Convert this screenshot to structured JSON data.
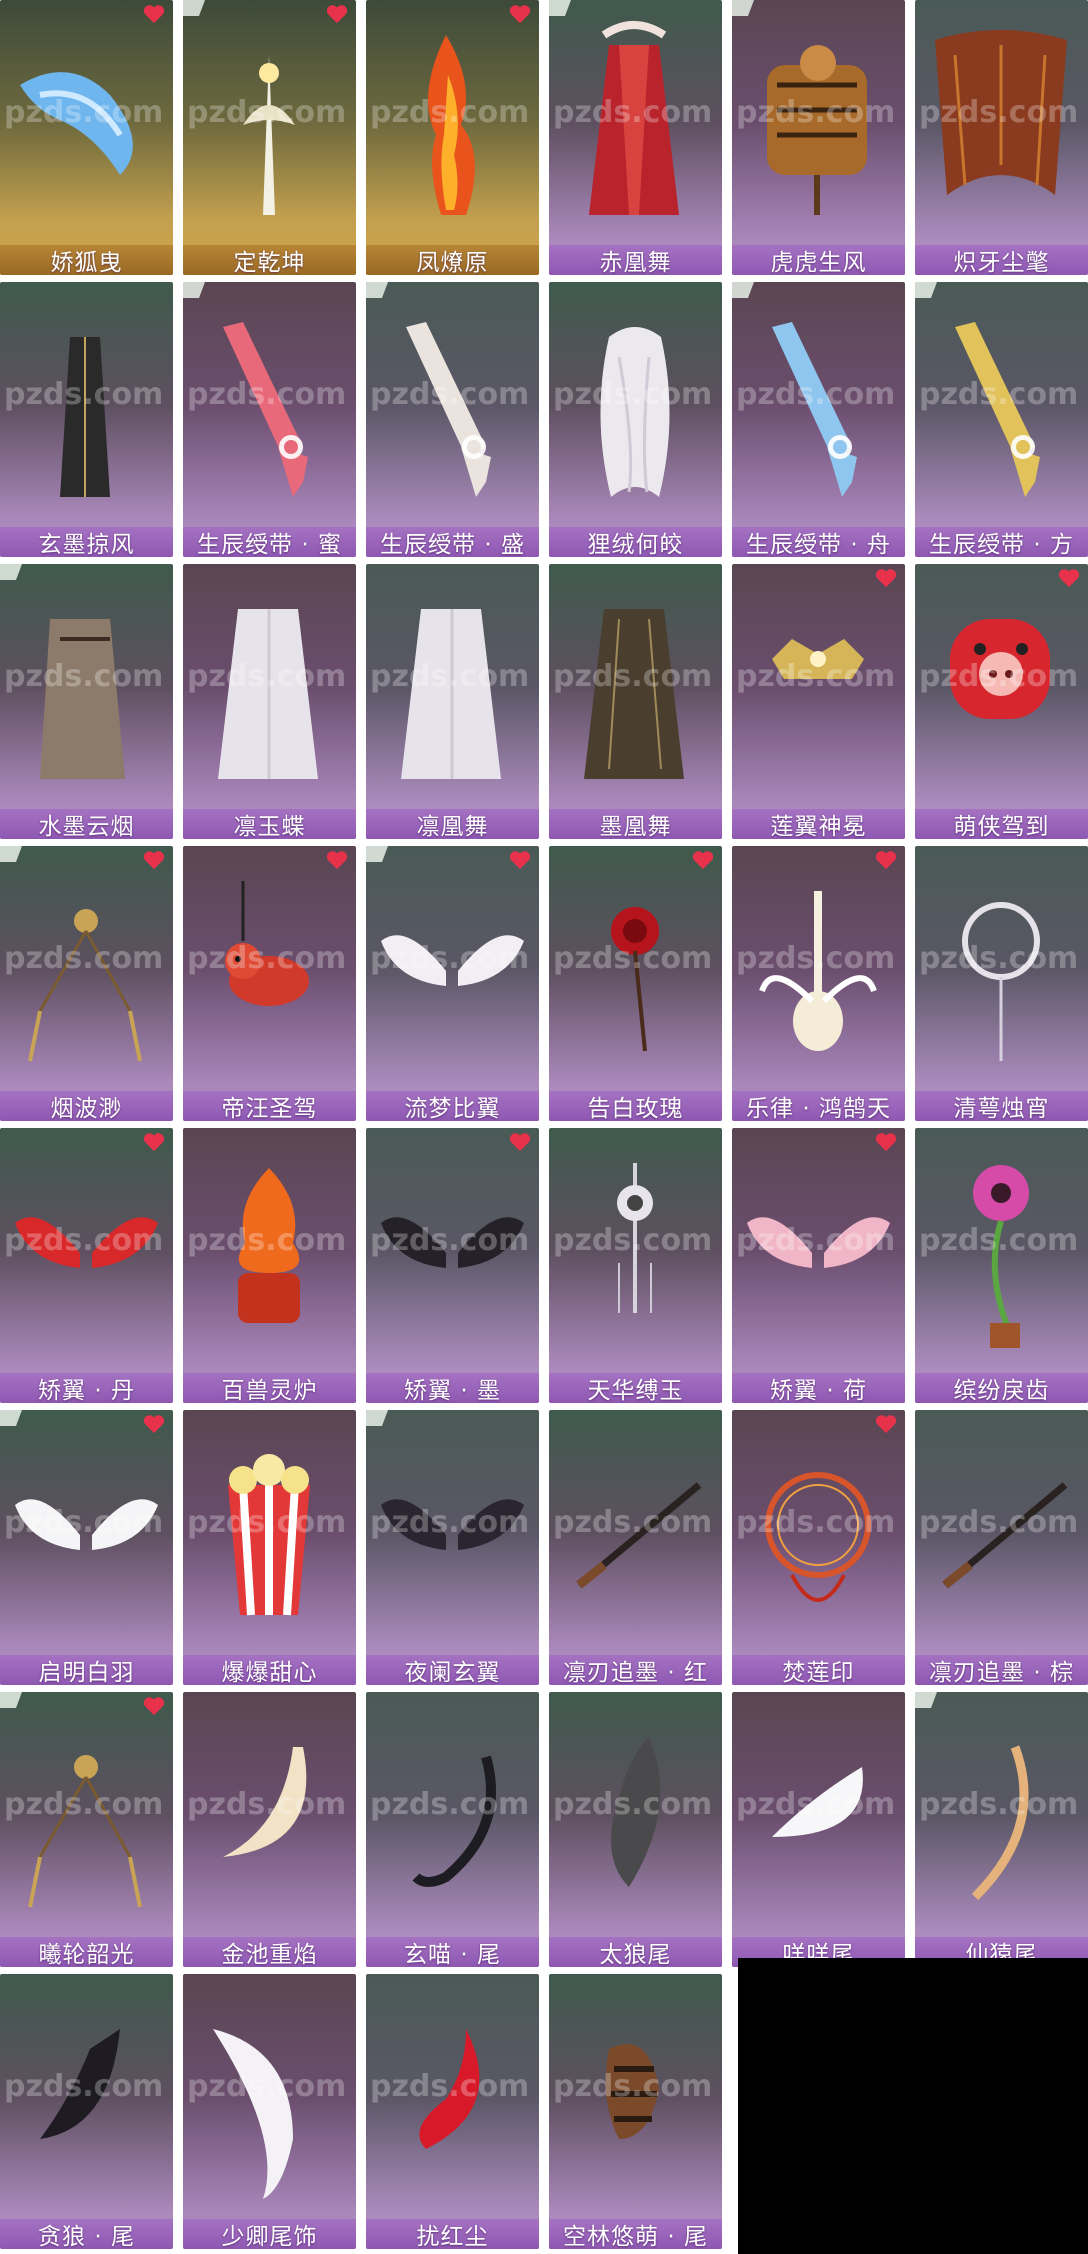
{
  "watermark": "pzds.com",
  "items": [
    {
      "name": "娇狐曳",
      "heart": true,
      "tag": false,
      "theme": "gold",
      "art": "tail-blue"
    },
    {
      "name": "定乾坤",
      "heart": true,
      "tag": true,
      "theme": "gold",
      "art": "sword-white"
    },
    {
      "name": "凤燎原",
      "heart": true,
      "tag": false,
      "theme": "gold",
      "art": "flame"
    },
    {
      "name": "赤凰舞",
      "heart": false,
      "tag": true,
      "theme": "purple",
      "art": "robe-red"
    },
    {
      "name": "虎虎生风",
      "heart": false,
      "tag": true,
      "theme": "purple",
      "art": "tiger"
    },
    {
      "name": "炽牙尘氅",
      "heart": false,
      "tag": false,
      "theme": "purple",
      "art": "cape-brown"
    },
    {
      "name": "玄墨掠风",
      "heart": false,
      "tag": false,
      "theme": "purple",
      "art": "cape-black"
    },
    {
      "name": "生辰绶带 · 蜜",
      "heart": false,
      "tag": true,
      "theme": "purple",
      "art": "sash-pink"
    },
    {
      "name": "生辰绶带 · 盛",
      "heart": false,
      "tag": true,
      "theme": "purple",
      "art": "sash-white"
    },
    {
      "name": "狸绒何皎",
      "heart": false,
      "tag": false,
      "theme": "purple",
      "art": "fur-white"
    },
    {
      "name": "生辰绶带 · 舟",
      "heart": false,
      "tag": true,
      "theme": "purple",
      "art": "sash-blue"
    },
    {
      "name": "生辰绶带 · 方",
      "heart": false,
      "tag": true,
      "theme": "purple",
      "art": "sash-gold"
    },
    {
      "name": "水墨云烟",
      "heart": false,
      "tag": true,
      "theme": "purple",
      "art": "robe-ink"
    },
    {
      "name": "凛玉蝶",
      "heart": false,
      "tag": false,
      "theme": "purple",
      "art": "robe-white"
    },
    {
      "name": "凛凰舞",
      "heart": false,
      "tag": false,
      "theme": "purple",
      "art": "robe-white2"
    },
    {
      "name": "墨凰舞",
      "heart": false,
      "tag": false,
      "theme": "purple",
      "art": "robe-dark"
    },
    {
      "name": "莲翼神冕",
      "heart": true,
      "tag": false,
      "theme": "purple",
      "art": "crown"
    },
    {
      "name": "萌侠驾到",
      "heart": true,
      "tag": false,
      "theme": "purple",
      "art": "pig"
    },
    {
      "name": "烟波渺",
      "heart": true,
      "tag": true,
      "theme": "purple",
      "art": "tassel"
    },
    {
      "name": "帝汪圣驾",
      "heart": true,
      "tag": false,
      "theme": "purple",
      "art": "fox"
    },
    {
      "name": "流梦比翼",
      "heart": true,
      "tag": true,
      "theme": "purple",
      "art": "wings-white-small"
    },
    {
      "name": "告白玫瑰",
      "heart": true,
      "tag": false,
      "theme": "purple",
      "art": "rose"
    },
    {
      "name": "乐律 · 鸿鹄天",
      "heart": true,
      "tag": false,
      "theme": "purple",
      "art": "guitar"
    },
    {
      "name": "清萼烛宵",
      "heart": false,
      "tag": false,
      "theme": "purple",
      "art": "lantern"
    },
    {
      "name": "矫翼 · 丹",
      "heart": true,
      "tag": false,
      "theme": "purple",
      "art": "wings-red"
    },
    {
      "name": "百兽灵炉",
      "heart": false,
      "tag": false,
      "theme": "purple",
      "art": "censer"
    },
    {
      "name": "矫翼 · 墨",
      "heart": true,
      "tag": false,
      "theme": "purple",
      "art": "wings-black"
    },
    {
      "name": "天华缚玉",
      "heart": false,
      "tag": false,
      "theme": "purple",
      "art": "pendant"
    },
    {
      "name": "矫翼 · 荷",
      "heart": true,
      "tag": false,
      "theme": "purple",
      "art": "wings-pink"
    },
    {
      "name": "缤纷戾齿",
      "heart": false,
      "tag": false,
      "theme": "purple",
      "art": "plant"
    },
    {
      "name": "启明白羽",
      "heart": true,
      "tag": true,
      "theme": "purple",
      "art": "wings-white"
    },
    {
      "name": "爆爆甜心",
      "heart": false,
      "tag": false,
      "theme": "purple",
      "art": "popcorn"
    },
    {
      "name": "夜阑玄翼",
      "heart": false,
      "tag": true,
      "theme": "purple",
      "art": "wings-black2"
    },
    {
      "name": "凛刃追墨 · 红",
      "heart": false,
      "tag": false,
      "theme": "purple",
      "art": "blade"
    },
    {
      "name": "焚莲印",
      "heart": true,
      "tag": false,
      "theme": "purple",
      "art": "ring-fire"
    },
    {
      "name": "凛刃追墨 · 棕",
      "heart": false,
      "tag": false,
      "theme": "purple",
      "art": "blade2"
    },
    {
      "name": "曦轮韶光",
      "heart": true,
      "tag": true,
      "theme": "purple",
      "art": "tassel2"
    },
    {
      "name": "金池重焰",
      "heart": false,
      "tag": false,
      "theme": "purple",
      "art": "tail-cream"
    },
    {
      "name": "玄喵 · 尾",
      "heart": false,
      "tag": false,
      "theme": "purple",
      "art": "tail-black-thin"
    },
    {
      "name": "太狼尾",
      "heart": false,
      "tag": false,
      "theme": "purple",
      "art": "tail-grey"
    },
    {
      "name": "咩咩尾",
      "heart": false,
      "tag": false,
      "theme": "purple",
      "art": "tail-white"
    },
    {
      "name": "仙猿尾",
      "heart": false,
      "tag": true,
      "theme": "purple",
      "art": "tail-tan"
    },
    {
      "name": "贪狼 · 尾",
      "heart": false,
      "tag": false,
      "theme": "purple",
      "art": "tail-black"
    },
    {
      "name": "少卿尾饰",
      "heart": false,
      "tag": false,
      "theme": "purple",
      "art": "tail-white2"
    },
    {
      "name": "扰红尘",
      "heart": false,
      "tag": false,
      "theme": "purple",
      "art": "tail-red"
    },
    {
      "name": "空林悠萌 · 尾",
      "heart": false,
      "tag": false,
      "theme": "purple",
      "art": "tail-raccoon"
    }
  ]
}
